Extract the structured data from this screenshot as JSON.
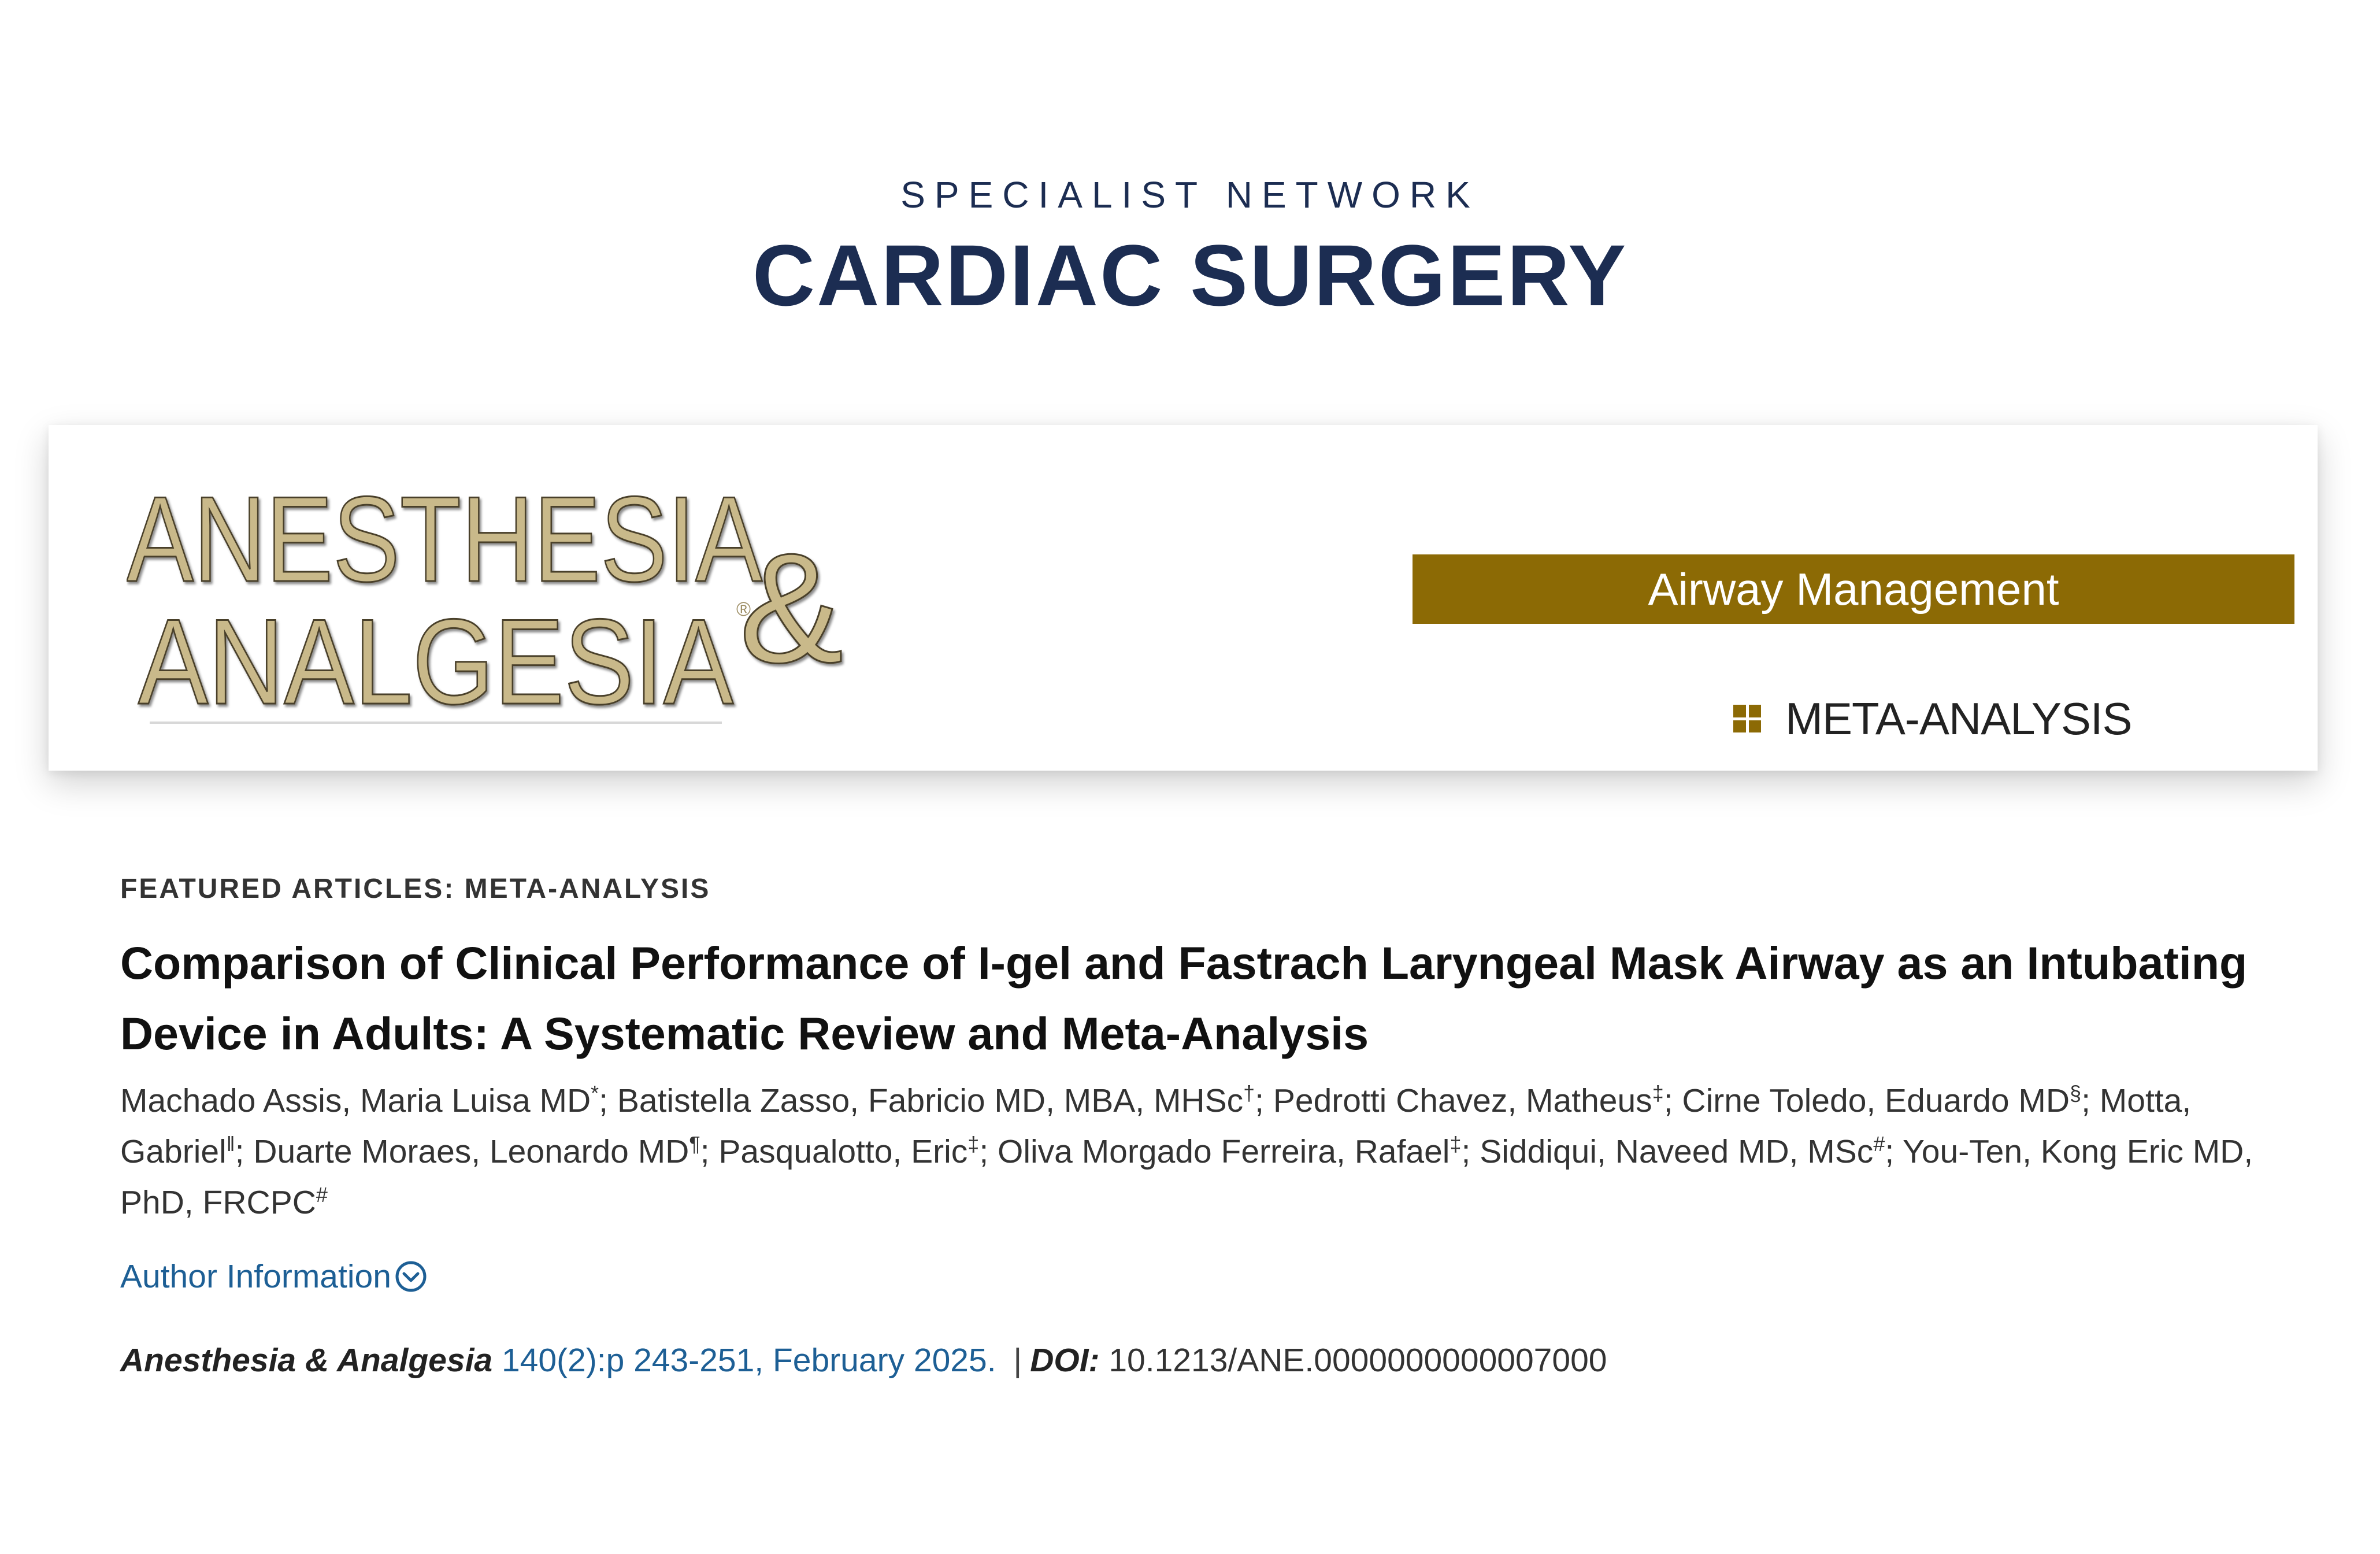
{
  "header": {
    "eyebrow": "SPECIALIST NETWORK",
    "title": "CARDIAC SURGERY"
  },
  "banner": {
    "logo_line1": "ANESTHESIA",
    "logo_line2": "ANALGESIA",
    "logo_ampersand": "&",
    "logo_registered": "®",
    "section_strip": "Airway Management",
    "article_type": "META-ANALYSIS",
    "colors": {
      "strip": "#8c6a05",
      "logo_text": "#c9b98a",
      "logo_outline": "#4a3f2a"
    }
  },
  "article": {
    "section_label": "FEATURED ARTICLES: META-ANALYSIS",
    "title": "Comparison of Clinical Performance of I-gel and Fastrach Laryngeal Mask Airway as an Intubating Device in Adults: A Systematic Review and Meta-Analysis",
    "authors": [
      {
        "name": "Machado Assis, Maria Luisa MD",
        "mark": "*"
      },
      {
        "name": "Batistella Zasso, Fabricio MD, MBA, MHSc",
        "mark": "†"
      },
      {
        "name": "Pedrotti Chavez, Matheus",
        "mark": "‡"
      },
      {
        "name": "Cirne Toledo, Eduardo MD",
        "mark": "§"
      },
      {
        "name": "Motta, Gabriel",
        "mark": "‖"
      },
      {
        "name": "Duarte Moraes, Leonardo MD",
        "mark": "¶"
      },
      {
        "name": "Pasqualotto, Eric",
        "mark": "‡"
      },
      {
        "name": "Oliva Morgado Ferreira, Rafael",
        "mark": "‡"
      },
      {
        "name": "Siddiqui, Naveed MD, MSc",
        "mark": "#"
      },
      {
        "name": "You-Ten, Kong Eric MD, PhD, FRCPC",
        "mark": "#"
      }
    ],
    "author_info_label": "Author Information",
    "citation": {
      "journal": "Anesthesia & Analgesia",
      "reference": "140(2):p 243-251, February 2025.",
      "separator": "|",
      "doi_label": "DOI:",
      "doi": "10.1213/ANE.0000000000007000"
    }
  },
  "icons": {
    "author_info": "chevron-down-circle-icon",
    "meta_analysis": "grid-squares-icon"
  },
  "colors": {
    "navy": "#1c2d52",
    "link": "#1d5f95",
    "gold": "#8c6a05"
  }
}
